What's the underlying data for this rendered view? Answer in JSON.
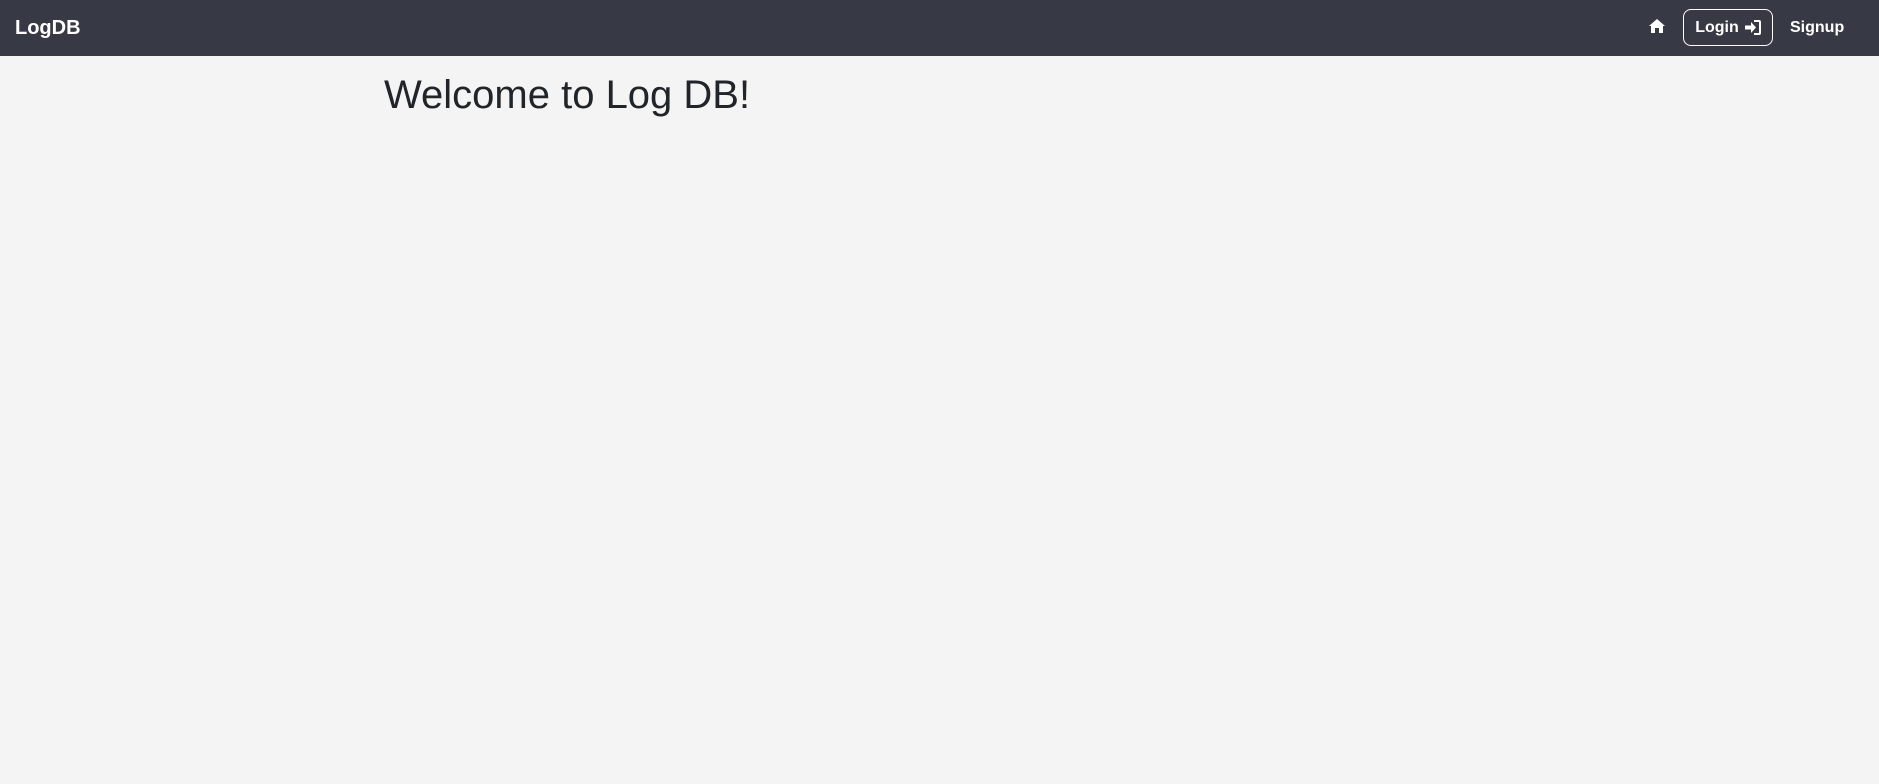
{
  "navbar": {
    "brand": "LogDB",
    "home_icon": "home-icon",
    "login_label": "Login",
    "login_icon": "sign-in-icon",
    "signup_label": "Signup"
  },
  "main": {
    "title": "Welcome to Log DB!"
  },
  "colors": {
    "navbar_bg": "#373a44",
    "page_bg": "#f4f4f4",
    "text": "#212529",
    "nav_text": "#ffffff"
  }
}
